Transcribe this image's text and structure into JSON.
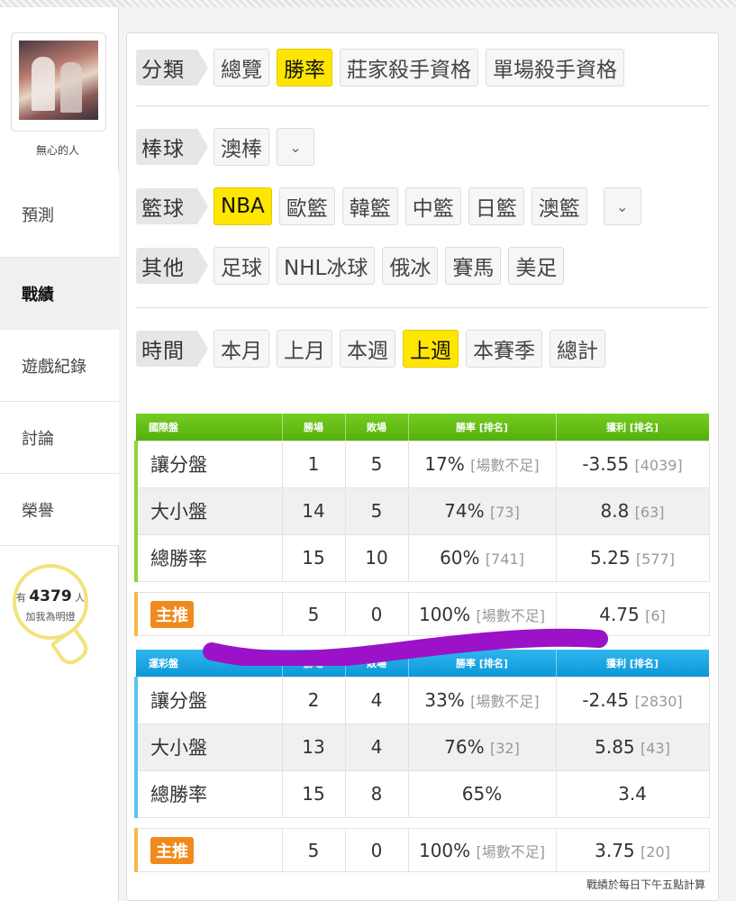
{
  "user": {
    "name": "無心的人"
  },
  "nav": [
    "預測",
    "戰績",
    "遊戲紀錄",
    "討論",
    "榮譽"
  ],
  "fans": {
    "prefix": "有",
    "count": "4379",
    "suffix": "人",
    "cta": "加我為明燈"
  },
  "filters": {
    "category": {
      "label": "分類",
      "options": [
        "總覽",
        "勝率",
        "莊家殺手資格",
        "單場殺手資格"
      ],
      "selected": "勝率"
    },
    "baseball": {
      "label": "棒球",
      "options": [
        "澳棒"
      ]
    },
    "basketball": {
      "label": "籃球",
      "options": [
        "NBA",
        "歐籃",
        "韓籃",
        "中籃",
        "日籃",
        "澳籃"
      ],
      "selected": "NBA"
    },
    "other": {
      "label": "其他",
      "options": [
        "足球",
        "NHL冰球",
        "俄冰",
        "賽馬",
        "美足"
      ]
    },
    "time": {
      "label": "時間",
      "options": [
        "本月",
        "上月",
        "本週",
        "上週",
        "本賽季",
        "總計"
      ],
      "selected": "上週"
    }
  },
  "international": {
    "headers": [
      "國際盤",
      "勝場",
      "敗場",
      "勝率 [排名]",
      "獲利 [排名]"
    ],
    "rows": [
      {
        "type": "讓分盤",
        "win": "1",
        "loss": "5",
        "rate": "17%",
        "rate_rank": "[場數不足]",
        "profit": "-3.55",
        "profit_rank": "[4039]"
      },
      {
        "type": "大小盤",
        "win": "14",
        "loss": "5",
        "rate": "74%",
        "rate_rank": "[73]",
        "profit": "8.8",
        "profit_rank": "[63]"
      },
      {
        "type": "總勝率",
        "win": "15",
        "loss": "10",
        "rate": "60%",
        "rate_rank": "[741]",
        "profit": "5.25",
        "profit_rank": "[577]"
      }
    ],
    "featured": {
      "label": "主推",
      "win": "5",
      "loss": "0",
      "rate": "100%",
      "rate_rank": "[場數不足]",
      "profit": "4.75",
      "profit_rank": "[6]"
    }
  },
  "sportslottery": {
    "headers": [
      "運彩盤",
      "勝場",
      "敗場",
      "勝率 [排名]",
      "獲利 [排名]"
    ],
    "rows": [
      {
        "type": "讓分盤",
        "win": "2",
        "loss": "4",
        "rate": "33%",
        "rate_rank": "[場數不足]",
        "profit": "-2.45",
        "profit_rank": "[2830]"
      },
      {
        "type": "大小盤",
        "win": "13",
        "loss": "4",
        "rate": "76%",
        "rate_rank": "[32]",
        "profit": "5.85",
        "profit_rank": "[43]"
      },
      {
        "type": "總勝率",
        "win": "15",
        "loss": "8",
        "rate": "65%",
        "rate_rank": "",
        "profit": "3.4",
        "profit_rank": ""
      }
    ],
    "featured": {
      "label": "主推",
      "win": "5",
      "loss": "0",
      "rate": "100%",
      "rate_rank": "[場數不足]",
      "profit": "3.75",
      "profit_rank": "[20]"
    }
  },
  "footnote": "戰績於每日下午五點計算",
  "colors": {
    "highlight": "#ffe600",
    "international_header": "#5cb812",
    "lottery_header": "#1ba6e2",
    "scribble": "#9b12c8",
    "badge": "#f08a1c"
  }
}
